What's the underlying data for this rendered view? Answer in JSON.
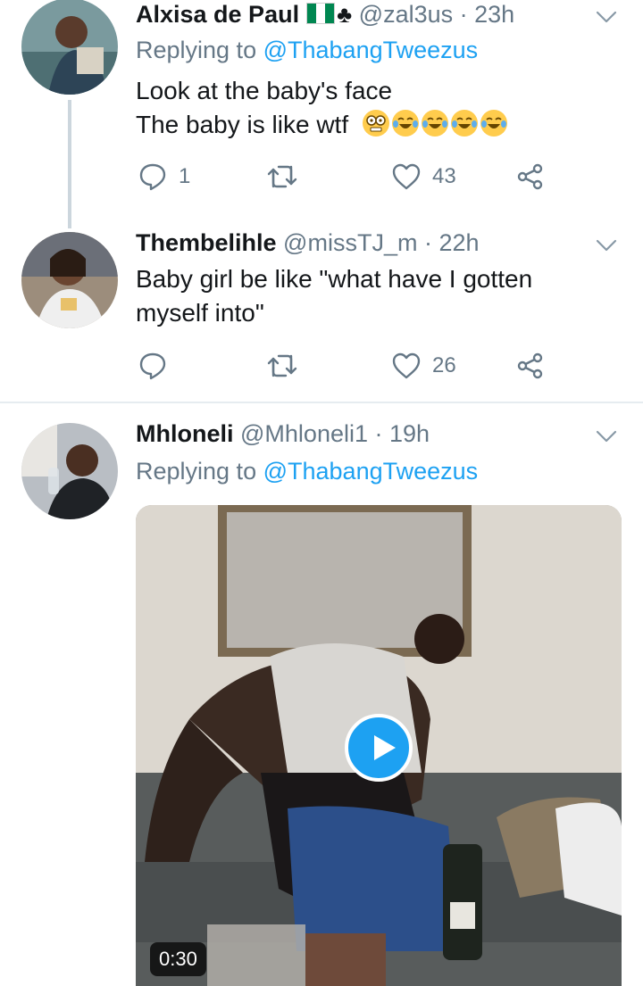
{
  "tweets": [
    {
      "name": "Alxisa de Paul",
      "handle": "@zal3us",
      "time": "· 23h",
      "replying_prefix": "Replying to",
      "replying_to": "@ThabangTweezus",
      "text_lines": [
        "Look at the baby's face",
        "The baby is like wtf"
      ],
      "flag_icon": "nigeria-flag-icon",
      "club_symbol": "♣",
      "emoji_icons": [
        "flushed-face-icon",
        "tears-of-joy-icon",
        "tears-of-joy-icon",
        "tears-of-joy-icon",
        "tears-of-joy-icon"
      ],
      "reply_count": "1",
      "retweet_count": "",
      "like_count": "43"
    },
    {
      "name": "Thembelihle",
      "handle": "@missTJ_m",
      "time": "· 22h",
      "text_lines": [
        "Baby girl be like \"what have I gotten",
        "myself into\""
      ],
      "reply_count": "",
      "retweet_count": "",
      "like_count": "26"
    },
    {
      "name": "Mhloneli",
      "handle": "@Mhloneli1",
      "time": "· 19h",
      "replying_prefix": "Replying to",
      "replying_to": "@ThabangTweezus",
      "media": {
        "type": "video",
        "duration": "0:30"
      }
    }
  ],
  "colors": {
    "accent": "#1da1f2",
    "secondary_text": "#657786",
    "divider": "#e6ecf0"
  }
}
